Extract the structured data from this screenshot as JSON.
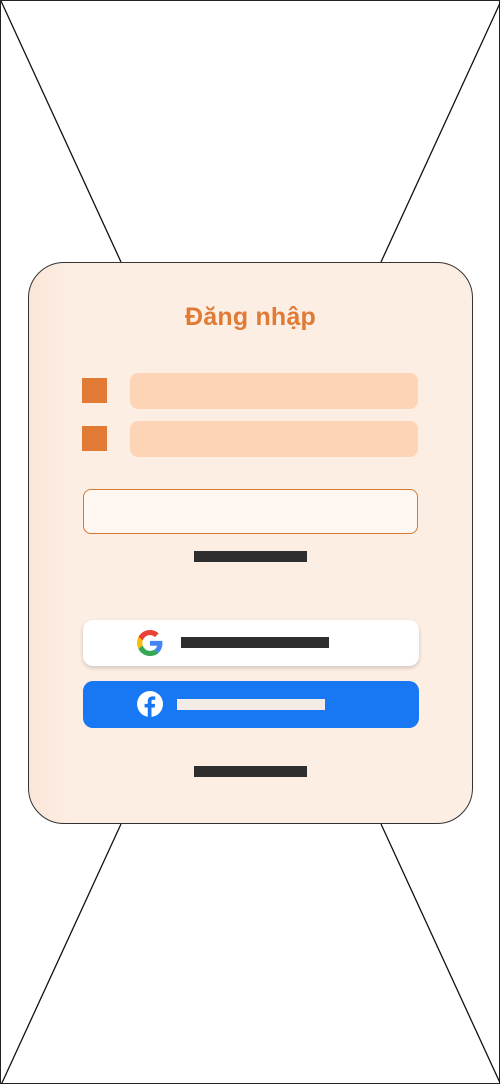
{
  "login_card": {
    "title": "Đăng nhập",
    "fields": [
      {
        "icon": "field-icon"
      },
      {
        "icon": "field-icon"
      }
    ],
    "google_button": {
      "icon": "google-icon"
    },
    "facebook_button": {
      "icon": "facebook-icon"
    }
  },
  "colors": {
    "accent": "#e07a35",
    "input_fill": "#fdd4b6",
    "card_fill": "#fdeee4",
    "facebook_blue": "#1877f2"
  }
}
